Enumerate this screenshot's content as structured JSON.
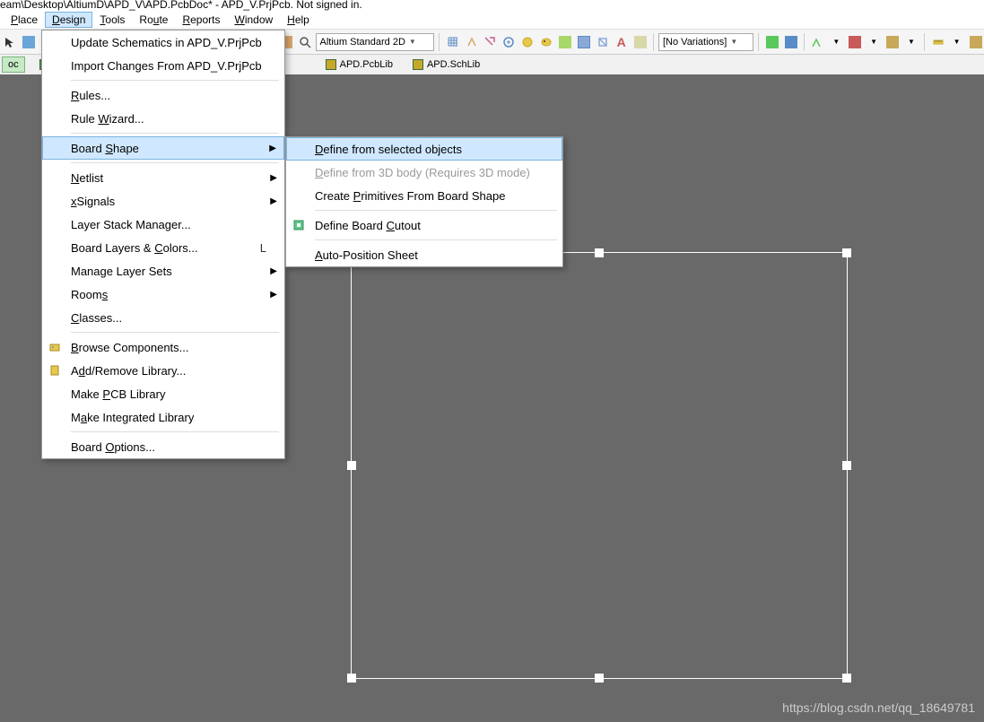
{
  "title": "eam\\Desktop\\AltiumD\\APD_V\\APD.PcbDoc* - APD_V.PrjPcb. Not signed in.",
  "menubar": {
    "place": "Place",
    "design": "Design",
    "tools": "Tools",
    "route": "Route",
    "reports": "Reports",
    "window": "Window",
    "help": "Help"
  },
  "toolbar": {
    "view_select_label": "Altium Standard 2D",
    "variations_label": "[No Variations]"
  },
  "doctabs": {
    "tab_active": "oc",
    "tab_pcblib": "APD.PcbLib",
    "tab_schlib": "APD.SchLib"
  },
  "menu": {
    "update_schematics": "Update Schematics in APD_V.PrjPcb",
    "import_changes": "Import Changes From APD_V.PrjPcb",
    "rules": "Rules...",
    "rule_wizard": "Rule Wizard...",
    "board_shape": "Board Shape",
    "netlist": "Netlist",
    "xsignals": "xSignals",
    "layer_stack": "Layer Stack Manager...",
    "board_layers": "Board Layers & Colors...",
    "board_layers_shortcut": "L",
    "manage_layer_sets": "Manage Layer Sets",
    "rooms": "Rooms",
    "classes": "Classes...",
    "browse_components": "Browse Components...",
    "add_remove_library": "Add/Remove Library...",
    "make_pcb_library": "Make PCB Library",
    "make_integrated_library": "Make Integrated Library",
    "board_options": "Board Options..."
  },
  "submenu": {
    "define_from_selected": "Define from selected objects",
    "define_from_3d": "Define from 3D body (Requires 3D mode)",
    "create_primitives": "Create Primitives From Board Shape",
    "define_cutout": "Define Board Cutout",
    "auto_position": "Auto-Position Sheet"
  },
  "watermark": "https://blog.csdn.net/qq_18649781"
}
